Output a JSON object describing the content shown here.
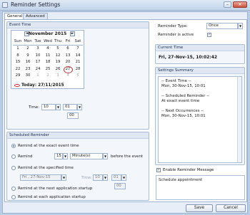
{
  "window": {
    "title": "Reminder Settings",
    "minimize": "–",
    "maximize": "□",
    "close": "✕"
  },
  "tabs": [
    {
      "label": "General"
    },
    {
      "label": "Advanced"
    }
  ],
  "event_time": {
    "group_title": "Event Time",
    "calendar": {
      "prev": "◄",
      "next": "►",
      "month_label": "November 2015",
      "weekdays": [
        "Sun",
        "Mon",
        "Tue",
        "Wed",
        "Thu",
        "Fri",
        "Sat"
      ],
      "weeks": [
        [
          [
            "1",
            ""
          ],
          [
            "2",
            ""
          ],
          [
            "3",
            ""
          ],
          [
            "4",
            ""
          ],
          [
            "5",
            ""
          ],
          [
            "6",
            ""
          ],
          [
            "7",
            ""
          ]
        ],
        [
          [
            "8",
            ""
          ],
          [
            "9",
            ""
          ],
          [
            "10",
            ""
          ],
          [
            "11",
            ""
          ],
          [
            "12",
            ""
          ],
          [
            "13",
            ""
          ],
          [
            "14",
            ""
          ]
        ],
        [
          [
            "15",
            ""
          ],
          [
            "16",
            ""
          ],
          [
            "17",
            ""
          ],
          [
            "18",
            ""
          ],
          [
            "19",
            ""
          ],
          [
            "20",
            ""
          ],
          [
            "21",
            ""
          ]
        ],
        [
          [
            "22",
            ""
          ],
          [
            "23",
            ""
          ],
          [
            "24",
            ""
          ],
          [
            "25",
            ""
          ],
          [
            "26",
            ""
          ],
          [
            "27",
            "circled"
          ],
          [
            "28",
            ""
          ]
        ],
        [
          [
            "29",
            ""
          ],
          [
            "30",
            ""
          ],
          [
            "1",
            "grey"
          ],
          [
            "2",
            "grey"
          ],
          [
            "3",
            "grey"
          ],
          [
            "4",
            "grey"
          ],
          [
            "5",
            "grey"
          ]
        ]
      ],
      "today_label": "Today: 27/11/2015"
    },
    "time_label": "Time:",
    "hour": "10",
    "minute": "01",
    "seconds": "00"
  },
  "scheduled_reminder": {
    "group_title": "Scheduled Reminder",
    "options": [
      {
        "label": "Remind at the exact event time",
        "selected": true,
        "enabled": true
      },
      {
        "label": "Remind",
        "selected": false,
        "enabled": true
      },
      {
        "label": "Remind at the specified time",
        "selected": false,
        "enabled": true
      },
      {
        "label": "Remind at the next application startup",
        "selected": false,
        "enabled": true
      },
      {
        "label": "Remind at each application startup",
        "selected": false,
        "enabled": true
      }
    ],
    "remind_amount": "15",
    "remind_unit": "Minute(s)",
    "before_event_label": "before the event",
    "specified_date": "Fri , 27-Nov-15",
    "specified_time_label": "Time:",
    "specified_hour": "10",
    "specified_minute": "01",
    "specified_seconds": "00"
  },
  "reminder_type": {
    "label": "Reminder Type:",
    "value": "Once"
  },
  "reminder_active": {
    "label": "Reminder is active",
    "checked": true
  },
  "current_time": {
    "group_title": "Current Time",
    "value": "Fri, 27-Nov-15, 10:02:42"
  },
  "settings_summary": {
    "group_title": "Settings Summary",
    "lines": [
      "-- Event Time --",
      "Mon, 30-Nov-15, 10:01",
      "",
      "-- Scheduled Reminder --",
      "At exact event time",
      "",
      "-- Next Occurrences --",
      "Mon, 30-Nov-15, 10:01"
    ]
  },
  "reminder_message": {
    "checkbox_label": "Enable Reminder Message",
    "checked": true,
    "text": "Schedule appointment"
  },
  "buttons": {
    "save": "Save",
    "cancel": "Cancel"
  },
  "colors": {
    "selection_blue": "#2a62b6",
    "circle_red": "#c43030",
    "window_bg": "#b9cde6"
  }
}
